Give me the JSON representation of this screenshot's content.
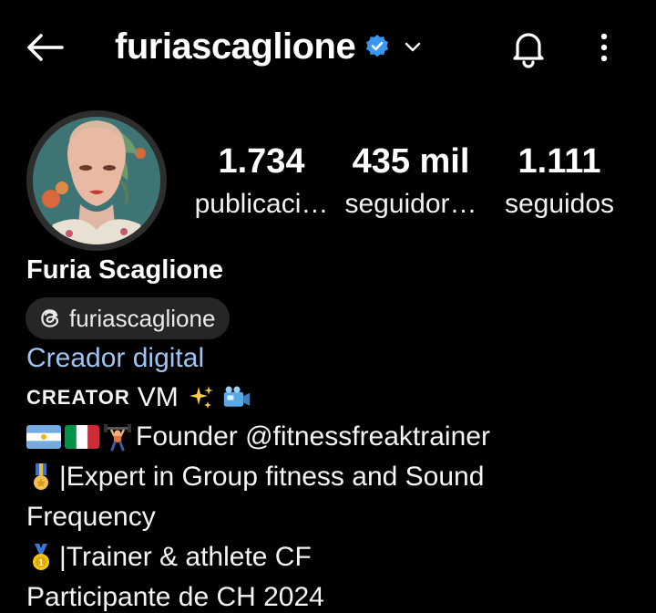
{
  "header": {
    "username": "furiascaglione",
    "icons": {
      "back": "arrow-left-icon",
      "verified": "verified-badge-icon",
      "dropdown": "chevron-down-icon",
      "notifications": "bell-icon",
      "more": "more-vertical-icon"
    },
    "accent_color": "#3897f0"
  },
  "stats": [
    {
      "value": "1.734",
      "label": "publicaci…"
    },
    {
      "value": "435 mil",
      "label": "seguidor…"
    },
    {
      "value": "1.111",
      "label": "seguidos"
    }
  ],
  "profile": {
    "full_name": "Furia Scaglione",
    "threads_handle": "furiascaglione",
    "category": "Creador digital",
    "category_color": "#9fc4f3"
  },
  "bio": {
    "line1_caps": "CREATOR",
    "line1_text": "VM",
    "line2_text": "Founder @fitnessfreaktrainer",
    "line3_text": "|Expert in Group fitness and Sound",
    "line4_text": "Frequency",
    "line5_text": "|Trainer & athlete CF",
    "line6_text": "Participante de CH 2024"
  }
}
